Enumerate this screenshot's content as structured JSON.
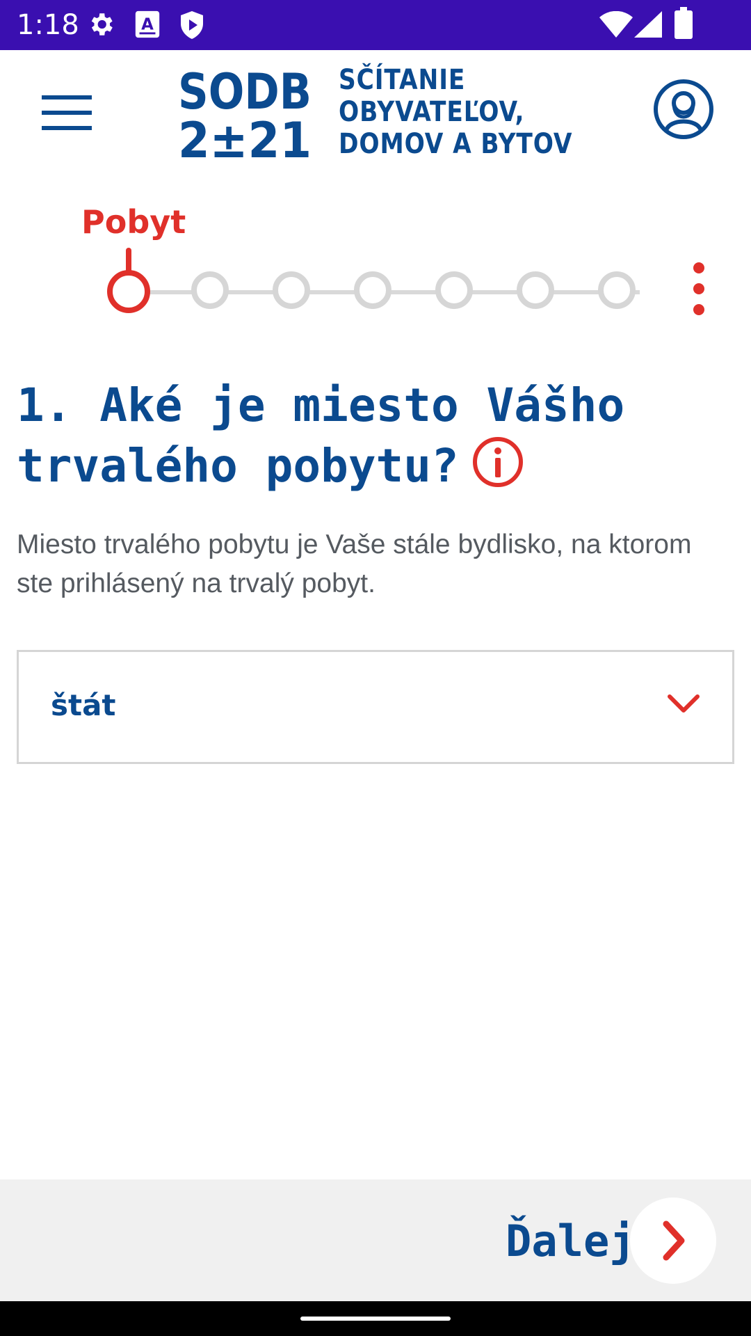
{
  "status_bar": {
    "time": "1:18",
    "icons_left": [
      "settings-icon",
      "accessibility-text-icon",
      "shield-play-icon"
    ],
    "icons_right": [
      "wifi-icon",
      "cellular-signal-icon",
      "battery-icon"
    ]
  },
  "header": {
    "menu_icon": "hamburger-menu-icon",
    "logo": {
      "mark_line1": "SODB",
      "mark_line2": "2±21",
      "text_lines": [
        "SČÍTANIE",
        "OBYVATEĽOV,",
        "DOMOV A BYTOV"
      ]
    },
    "profile_icon": "user-profile-icon"
  },
  "stepper": {
    "current_label": "Pobyt",
    "total_steps": 7,
    "current_index": 0,
    "more_icon": "more-vertical-icon"
  },
  "question": {
    "title": "1. Aké je miesto Vášho trvalého pobytu?",
    "info_icon": "info-circle-icon",
    "description": "Miesto trvalého pobytu je Vaše stále bydlisko, na ktorom ste prihlásený na trvalý pobyt."
  },
  "select": {
    "value": "štát",
    "chevron_icon": "chevron-down-icon"
  },
  "footer": {
    "next_label": "Ďalej",
    "next_icon": "chevron-right-icon"
  },
  "colors": {
    "status_bar": "#3a0fb0",
    "brand_blue": "#0b4a8f",
    "accent_red": "#e0302a",
    "inactive_gray": "#d6d6d6",
    "footer_bg": "#f0f0f0"
  }
}
